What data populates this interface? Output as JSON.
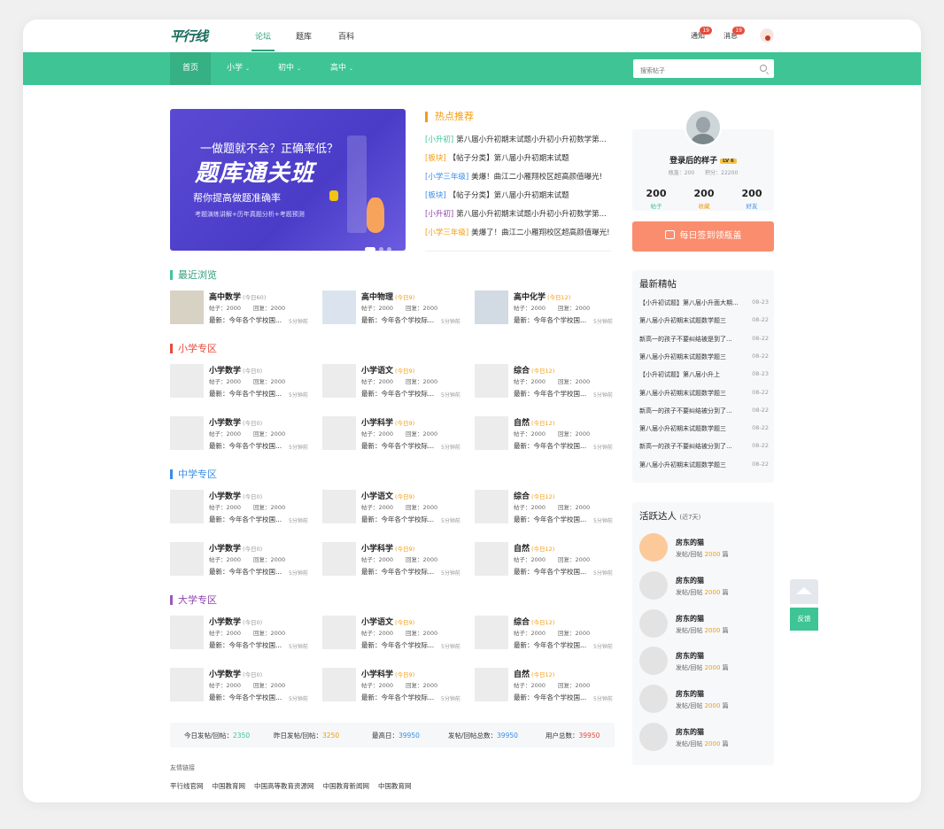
{
  "colors": {
    "brand": "#3ec495",
    "orange": "#f39c12",
    "red": "#e74c3c",
    "blue": "#3a8ee6",
    "purple": "#8e44ad",
    "signin": "#f98d6e"
  },
  "logo": "平行线",
  "top_tabs": [
    "论坛",
    "题库",
    "百科"
  ],
  "notices": {
    "label": "通知",
    "count": "19"
  },
  "messages": {
    "label": "消息",
    "count": "19"
  },
  "nav": {
    "items": [
      "首页",
      "小学",
      "初中",
      "高中"
    ]
  },
  "search": {
    "placeholder": "搜索帖子"
  },
  "banner": {
    "line1": "一做题就不会？正确率低？",
    "line2": "题库通关班",
    "line3": "帮你提高做题准确率",
    "line4": "考题演练讲解+历年真题分析+考题预测"
  },
  "hot": {
    "title": "热点推荐",
    "items": [
      {
        "tag": "[小升初]",
        "text": "第八届小升初期末试题小升初小升初数学第...",
        "color": "#3ec495"
      },
      {
        "tag": "[板块]",
        "text": "【帖子分类】第八届小升初期末试题",
        "color": "#f39c12"
      },
      {
        "tag": "[小学三年级]",
        "text": "美爆！曲江二小雁翔校区超高颜值曝光!",
        "color": "#3a8ee6"
      },
      {
        "tag": "[板块]",
        "text": "【帖子分类】第八届小升初期末试题",
        "color": "#3a8ee6"
      },
      {
        "tag": "[小升初]",
        "text": "第八届小升初期末试题小升初小升初数学第...",
        "color": "#8e44ad"
      },
      {
        "tag": "[小学三年级]",
        "text": "美爆了！曲江二小雁翔校区超高颜值曝光!",
        "color": "#f39c12"
      }
    ]
  },
  "recent": {
    "title": "最近浏览",
    "forums": [
      {
        "name": "高中数学",
        "today": "(今日60)",
        "posts": "帖子：2000",
        "replies": "回复：2000",
        "latest": "最新：今年各个学校国...",
        "ago": "5分钟前"
      },
      {
        "name": "高中物理",
        "today": "(今日9)",
        "posts": "帖子：2000",
        "replies": "回复：2000",
        "latest": "最新：今年各个学校际...",
        "ago": "5分钟前"
      },
      {
        "name": "高中化学",
        "today": "(今日12)",
        "posts": "帖子：2000",
        "replies": "回复：2000",
        "latest": "最新：今年各个学校国...",
        "ago": "5分钟前"
      }
    ]
  },
  "sections": [
    {
      "title": "小学专区",
      "forums": [
        {
          "name": "小学数学",
          "today": "(今日0)",
          "posts": "帖子：2000",
          "replies": "回复：2000",
          "latest": "最新：今年各个学校国...",
          "ago": "5分钟前"
        },
        {
          "name": "小学语文",
          "today": "(今日9)",
          "posts": "帖子：2000",
          "replies": "回复：2000",
          "latest": "最新：今年各个学校际...",
          "ago": "5分钟前"
        },
        {
          "name": "综合",
          "today": "(今日12)",
          "posts": "帖子：2000",
          "replies": "回复：2000",
          "latest": "最新：今年各个学校国...",
          "ago": "5分钟前"
        },
        {
          "name": "小学数学",
          "today": "(今日0)",
          "posts": "帖子：2000",
          "replies": "回复：2000",
          "latest": "最新：今年各个学校国...",
          "ago": "5分钟前"
        },
        {
          "name": "小学科学",
          "today": "(今日9)",
          "posts": "帖子：2000",
          "replies": "回复：2000",
          "latest": "最新：今年各个学校际...",
          "ago": "5分钟前"
        },
        {
          "name": "自然",
          "today": "(今日12)",
          "posts": "帖子：2000",
          "replies": "回复：2000",
          "latest": "最新：今年各个学校国...",
          "ago": "5分钟前"
        }
      ]
    },
    {
      "title": "中学专区",
      "forums": [
        {
          "name": "小学数学",
          "today": "(今日0)",
          "posts": "帖子：2000",
          "replies": "回复：2000",
          "latest": "最新：今年各个学校国...",
          "ago": "5分钟前"
        },
        {
          "name": "小学语文",
          "today": "(今日9)",
          "posts": "帖子：2000",
          "replies": "回复：2000",
          "latest": "最新：今年各个学校际...",
          "ago": "5分钟前"
        },
        {
          "name": "综合",
          "today": "(今日12)",
          "posts": "帖子：2000",
          "replies": "回复：2000",
          "latest": "最新：今年各个学校国...",
          "ago": "5分钟前"
        },
        {
          "name": "小学数学",
          "today": "(今日0)",
          "posts": "帖子：2000",
          "replies": "回复：2000",
          "latest": "最新：今年各个学校国...",
          "ago": "5分钟前"
        },
        {
          "name": "小学科学",
          "today": "(今日9)",
          "posts": "帖子：2000",
          "replies": "回复：2000",
          "latest": "最新：今年各个学校际...",
          "ago": "5分钟前"
        },
        {
          "name": "自然",
          "today": "(今日12)",
          "posts": "帖子：2000",
          "replies": "回复：2000",
          "latest": "最新：今年各个学校国...",
          "ago": "5分钟前"
        }
      ]
    },
    {
      "title": "大学专区",
      "forums": [
        {
          "name": "小学数学",
          "today": "(今日0)",
          "posts": "帖子：2000",
          "replies": "回复：2000",
          "latest": "最新：今年各个学校国...",
          "ago": "5分钟前"
        },
        {
          "name": "小学语文",
          "today": "(今日9)",
          "posts": "帖子：2000",
          "replies": "回复：2000",
          "latest": "最新：今年各个学校际...",
          "ago": "5分钟前"
        },
        {
          "name": "综合",
          "today": "(今日12)",
          "posts": "帖子：2000",
          "replies": "回复：2000",
          "latest": "最新：今年各个学校国...",
          "ago": "5分钟前"
        },
        {
          "name": "小学数学",
          "today": "(今日0)",
          "posts": "帖子：2000",
          "replies": "回复：2000",
          "latest": "最新：今年各个学校国...",
          "ago": "5分钟前"
        },
        {
          "name": "小学科学",
          "today": "(今日9)",
          "posts": "帖子：2000",
          "replies": "回复：2000",
          "latest": "最新：今年各个学校际...",
          "ago": "5分钟前"
        },
        {
          "name": "自然",
          "today": "(今日12)",
          "posts": "帖子：2000",
          "replies": "回复：2000",
          "latest": "最新：今年各个学校国...",
          "ago": "5分钟前"
        }
      ]
    }
  ],
  "stats": [
    {
      "label": "今日发帖/回帖：",
      "value": "2350",
      "color": "#3ec495"
    },
    {
      "label": "昨日发帖/回帖：",
      "value": "3250",
      "color": "#f39c12"
    },
    {
      "label": "最高日：",
      "value": "39950",
      "color": "#3a8ee6"
    },
    {
      "label": "发帖/回帖总数：",
      "value": "39950",
      "color": "#3a8ee6"
    },
    {
      "label": "用户总数：",
      "value": "39950",
      "color": "#e74c3c"
    }
  ],
  "links": {
    "title": "友情链接",
    "items": [
      "平行线官网",
      "中国教育网",
      "中国高等教育资源网",
      "中国教育新闻网",
      "中国教育网"
    ]
  },
  "profile": {
    "name": "登录后的样子",
    "level": "LV 6",
    "sub": "瓶盖：200　　积分：22200",
    "stats": [
      {
        "n": "200",
        "l": "帖子",
        "color": "#3ec495"
      },
      {
        "n": "200",
        "l": "收藏",
        "color": "#f39c12"
      },
      {
        "n": "200",
        "l": "好友",
        "color": "#3a8ee6"
      }
    ]
  },
  "signin": "每日签到领瓶盖",
  "top_posts": {
    "title": "最新精帖",
    "items": [
      {
        "t": "【小升初试题】第八届小升面大期...",
        "d": "08-23"
      },
      {
        "t": "第八届小升初期末试题数学题三",
        "d": "08-22"
      },
      {
        "t": "新高一的孩子不要纠结被是到了...",
        "d": "08-22"
      },
      {
        "t": "第八届小升初期末试题数学题三",
        "d": "08-22"
      },
      {
        "t": "【小升初试题】第八届小升上",
        "d": "08-23"
      },
      {
        "t": "第八届小升初期末试题数学题三",
        "d": "08-22"
      },
      {
        "t": "新高一的孩子不要纠结被分到了...",
        "d": "08-22"
      },
      {
        "t": "第八届小升初期末试题数学题三",
        "d": "08-22"
      },
      {
        "t": "新高一的孩子不要纠结被分到了...",
        "d": "08-22"
      },
      {
        "t": "第八届小升初期末试题数学题三",
        "d": "08-22"
      }
    ]
  },
  "active_users": {
    "title": "活跃达人",
    "sub": "(近7天)",
    "users": [
      {
        "name": "房东的猫",
        "stat": "发帖/回帖",
        "count": "2000",
        "unit": "篇"
      },
      {
        "name": "房东的猫",
        "stat": "发帖/回帖",
        "count": "2000",
        "unit": "篇"
      },
      {
        "name": "房东的猫",
        "stat": "发帖/回帖",
        "count": "2000",
        "unit": "篇"
      },
      {
        "name": "房东的猫",
        "stat": "发帖/回帖",
        "count": "2000",
        "unit": "篇"
      },
      {
        "name": "房东的猫",
        "stat": "发帖/回帖",
        "count": "2000",
        "unit": "篇"
      },
      {
        "name": "房东的猫",
        "stat": "发帖/回帖",
        "count": "2000",
        "unit": "篇"
      }
    ]
  },
  "feedback": "反馈"
}
